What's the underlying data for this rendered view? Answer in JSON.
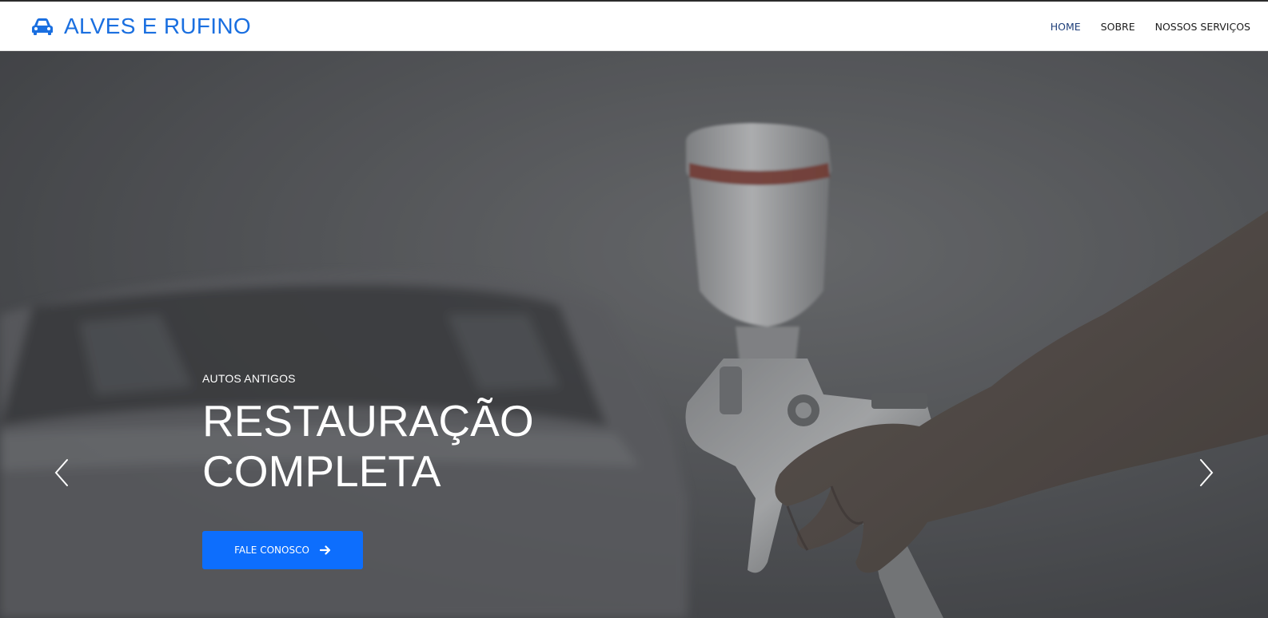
{
  "brand": {
    "name": "ALVES E RUFINO",
    "icon": "car-icon",
    "color": "#1a6fe0"
  },
  "nav": {
    "items": [
      {
        "label": "HOME",
        "active": true
      },
      {
        "label": "SOBRE",
        "active": false
      },
      {
        "label": "NOSSOS SERVIÇOS",
        "active": false
      }
    ]
  },
  "hero": {
    "kicker": "AUTOS ANTIGOS",
    "title_line1": "RESTAURAÇÃO",
    "title_line2": "COMPLETA",
    "cta_label": "FALE CONOSCO",
    "cta_icon": "arrow-right-icon",
    "cta_color": "#0d6efd",
    "prev_icon": "chevron-left-icon",
    "next_icon": "chevron-right-icon"
  }
}
